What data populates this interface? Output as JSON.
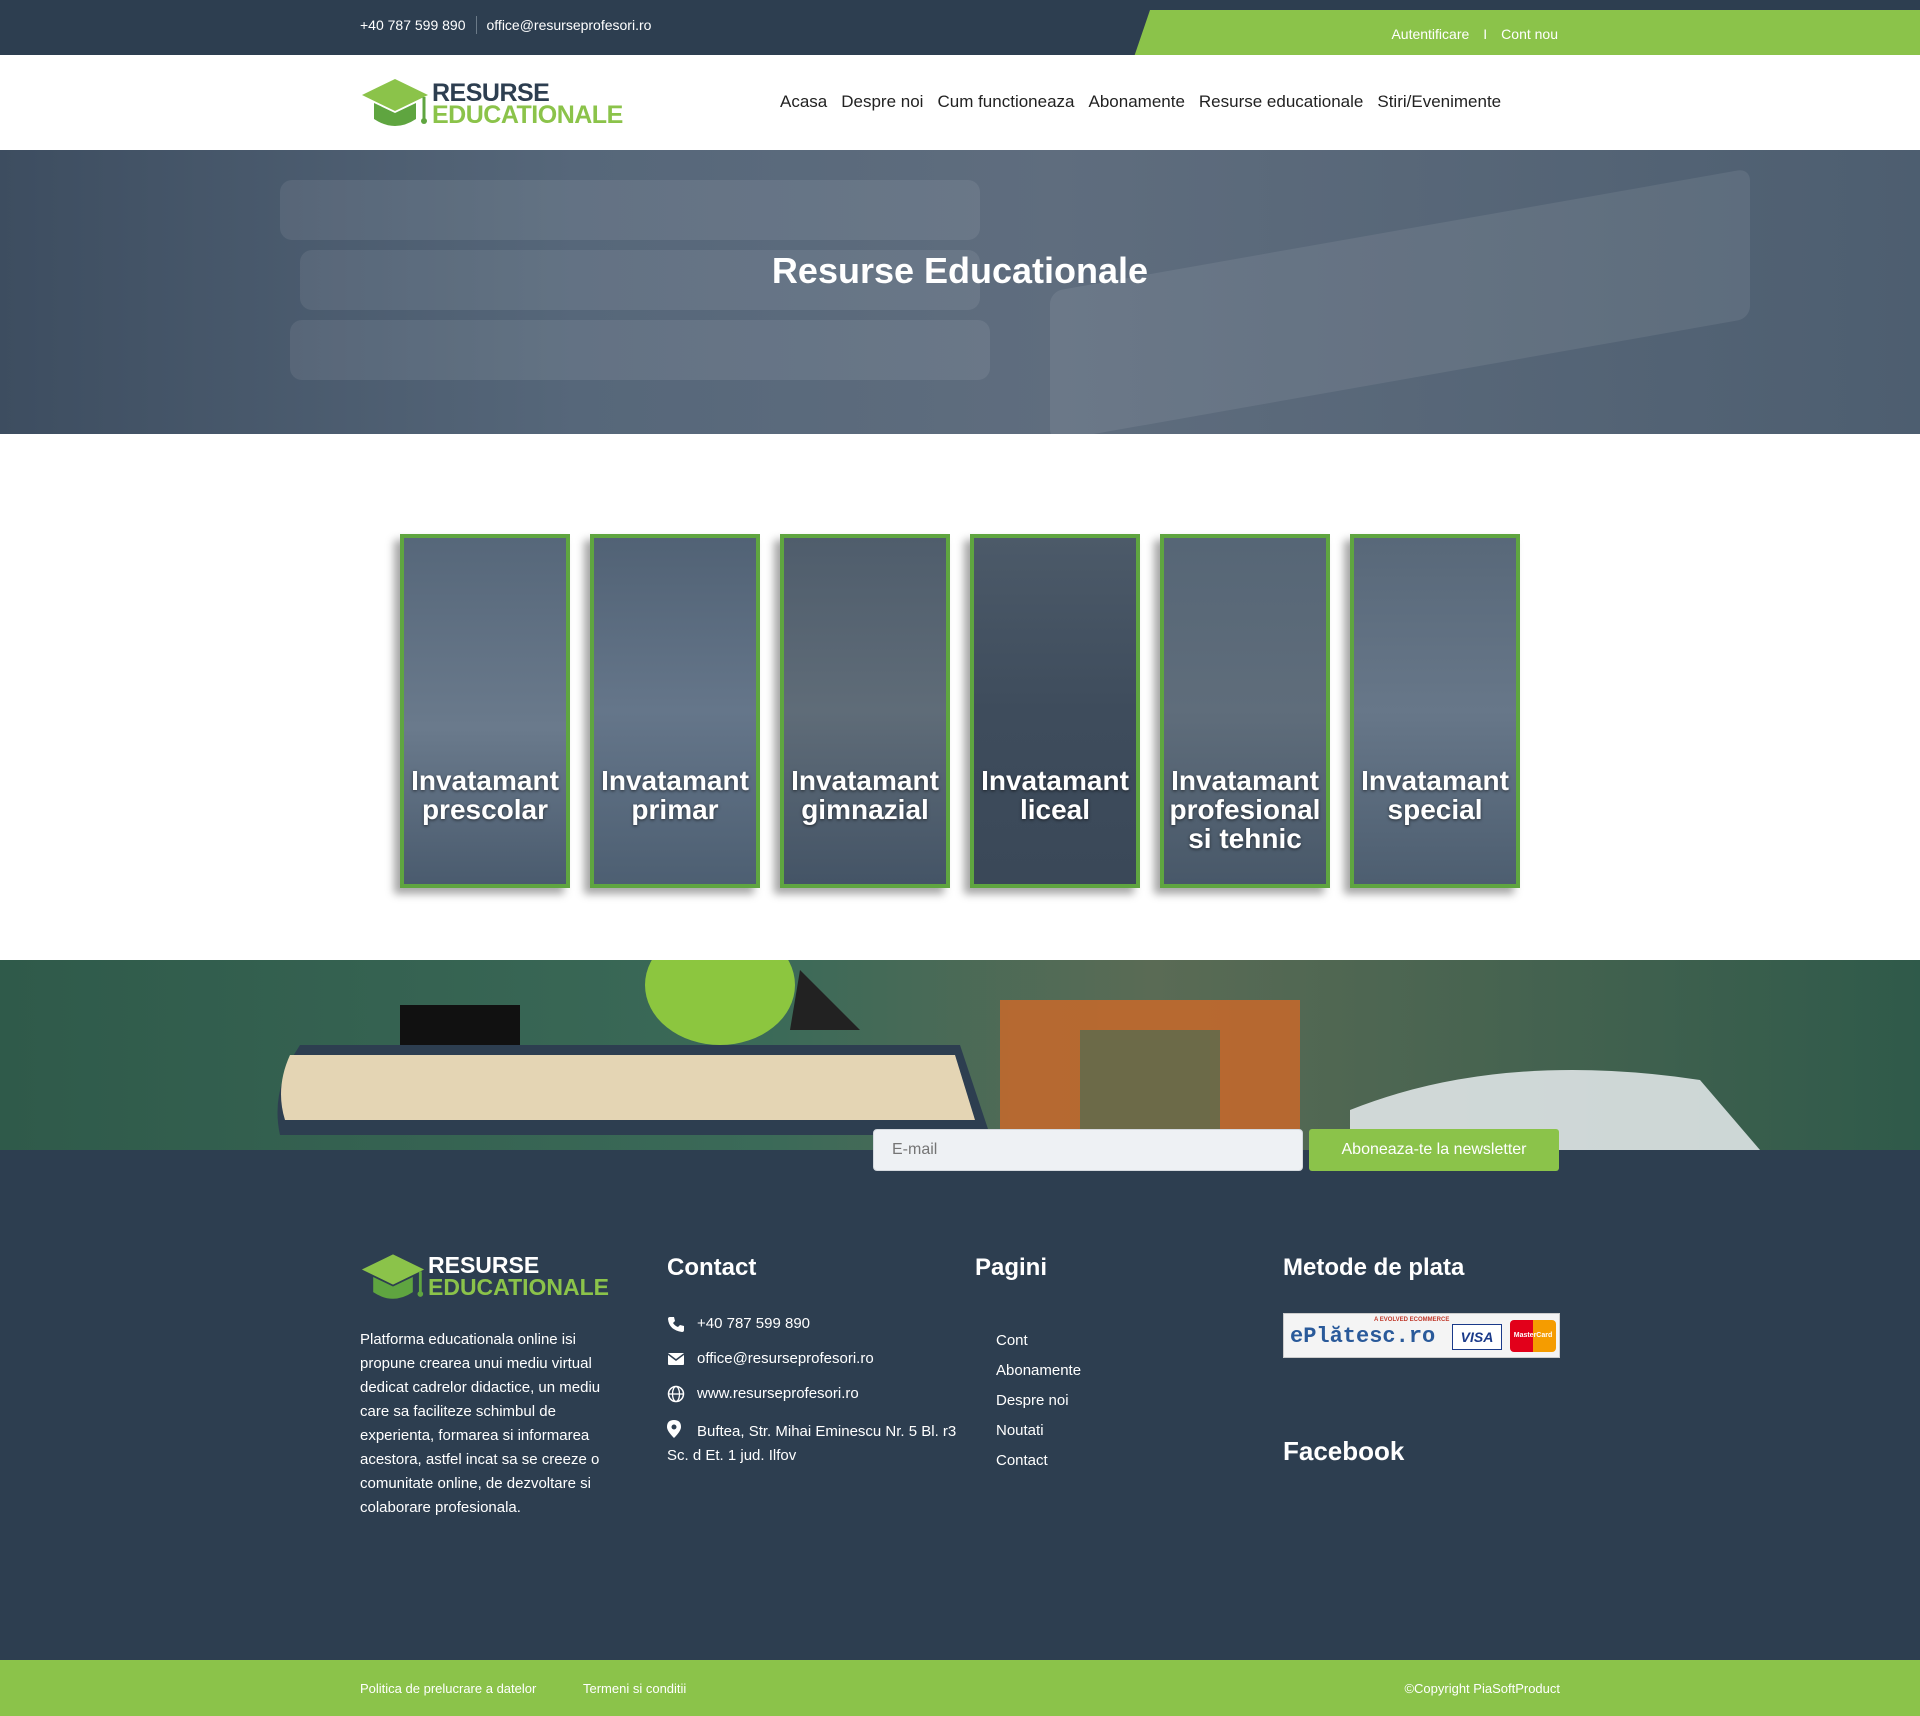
{
  "topbar": {
    "phone": "+40 787 599 890",
    "email": "office@resurseprofesori.ro",
    "login": "Autentificare",
    "separator": "I",
    "register": "Cont nou"
  },
  "logo": {
    "line1": "RESURSE",
    "line2": "EDUCATIONALE"
  },
  "nav": [
    "Acasa",
    "Despre noi",
    "Cum functioneaza",
    "Abonamente",
    "Resurse educationale",
    "Stiri/Evenimente"
  ],
  "hero": {
    "title": "Resurse Educationale"
  },
  "categories": [
    {
      "label": "Invatamant prescolar"
    },
    {
      "label": "Invatamant primar"
    },
    {
      "label": "Invatamant gimnazial"
    },
    {
      "label": "Invatamant liceal"
    },
    {
      "label": "Invatamant profesional si tehnic"
    },
    {
      "label": "Invatamant special"
    }
  ],
  "newsletter": {
    "placeholder": "E-mail",
    "button": "Aboneaza-te la newsletter"
  },
  "footer": {
    "description": "Platforma educationala online isi propune crearea unui mediu virtual dedicat cadrelor didactice, un mediu care sa faciliteze schimbul de experienta, formarea si informarea acestora, astfel incat sa se creeze o comunitate online, de dezvoltare si colaborare profesionala.",
    "contact_title": "Contact",
    "contact": {
      "phone": "+40 787 599 890",
      "email": "office@resurseprofesori.ro",
      "web": "www.resurseprofesori.ro",
      "address": "Buftea, Str. Mihai Eminescu Nr. 5 Bl. r3 Sc. d Et. 1 jud. Ilfov"
    },
    "pages_title": "Pagini",
    "pages": [
      "Cont",
      "Abonamente",
      "Despre noi",
      "Noutati",
      "Contact"
    ],
    "payment_title": "Metode de plata",
    "payment": {
      "brand": "ePlătesc.ro",
      "tagline": "A EVOLVED ECOMMERCE",
      "visa": "VISA",
      "mastercard": "MasterCard"
    },
    "facebook_title": "Facebook"
  },
  "bottombar": {
    "privacy": "Politica de prelucrare a datelor",
    "terms": "Termeni si conditii",
    "copyright": "©Copyright PiaSoftProduct"
  },
  "colors": {
    "primary": "#2d3e50",
    "accent": "#8bc34a",
    "card_border": "#5fa540"
  }
}
